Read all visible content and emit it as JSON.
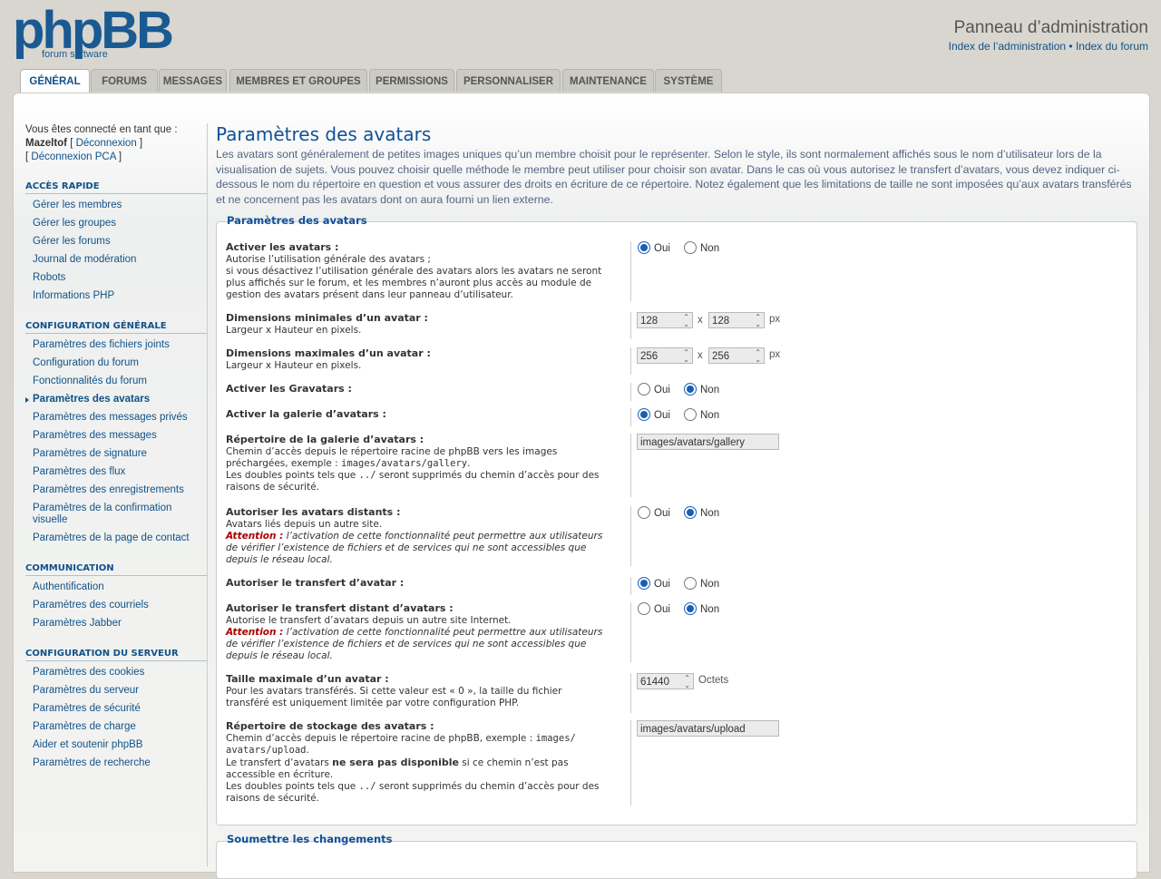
{
  "header": {
    "logo_main": "phpBB",
    "logo_sub": "forum software",
    "admin_title": "Panneau d’administration",
    "link_admin_index": "Index de l’administration",
    "link_separator": "•",
    "link_forum_index": "Index du forum"
  },
  "tabs": [
    "GÉNÉRAL",
    "FORUMS",
    "MESSAGES",
    "MEMBRES ET GROUPES",
    "PERMISSIONS",
    "PERSONNALISER",
    "MAINTENANCE",
    "SYSTÈME"
  ],
  "user": {
    "logged_as": "Vous êtes connecté en tant que :",
    "username": "Mazeltof",
    "logout": "Déconnexion",
    "logout_acp": "Déconnexion PCA"
  },
  "menu": [
    {
      "title": "ACCÈS RAPIDE",
      "items": [
        "Gérer les membres",
        "Gérer les groupes",
        "Gérer les forums",
        "Journal de modération",
        "Robots",
        "Informations PHP"
      ]
    },
    {
      "title": "CONFIGURATION GÉNÉRALE",
      "items": [
        "Paramètres des fichiers joints",
        "Configuration du forum",
        "Fonctionnalités du forum",
        "Paramètres des avatars",
        "Paramètres des messages privés",
        "Paramètres des messages",
        "Paramètres de signature",
        "Paramètres des flux",
        "Paramètres des enregistrements",
        "Paramètres de la confirmation visuelle",
        "Paramètres de la page de contact"
      ]
    },
    {
      "title": "COMMUNICATION",
      "items": [
        "Authentification",
        "Paramètres des courriels",
        "Paramètres Jabber"
      ]
    },
    {
      "title": "CONFIGURATION DU SERVEUR",
      "items": [
        "Paramètres des cookies",
        "Paramètres du serveur",
        "Paramètres de sécurité",
        "Paramètres de charge",
        "Aider et soutenir phpBB",
        "Paramètres de recherche"
      ]
    }
  ],
  "page": {
    "title": "Paramètres des avatars",
    "intro": "Les avatars sont généralement de petites images uniques qu’un membre choisit pour le représenter. Selon le style, ils sont normalement affichés sous le nom d’utilisateur lors de la visualisation de sujets. Vous pouvez choisir quelle méthode le membre peut utiliser pour choisir son avatar. Dans le cas où vous autorisez le transfert d’avatars, vous devez indiquer ci-dessous le nom du répertoire en question et vous assurer des droits en écriture de ce répertoire. Notez également que les limitations de taille ne sont imposées qu’aux avatars transférés et ne concernent pas les avatars dont on aura fourni un lien externe.",
    "legend": "Paramètres des avatars",
    "submit_legend": "Soumettre les changements"
  },
  "common": {
    "yes": "Oui",
    "no": "Non",
    "px": "px",
    "x": "x",
    "octets": "Octets",
    "attention": "Attention :"
  },
  "settings": {
    "enable": {
      "title": "Activer les avatars :",
      "l1": "Autorise l’utilisation générale des avatars ;",
      "l2": "si vous désactivez l’utilisation générale des avatars alors les avatars ne seront",
      "l3": "plus affichés sur le forum, et les membres n’auront plus accès au module de",
      "l4": "gestion des avatars présent dans leur panneau d’utilisateur.",
      "value": "oui"
    },
    "min": {
      "title": "Dimensions minimales d’un avatar :",
      "desc": "Largeur x Hauteur en pixels.",
      "w": "128",
      "h": "128"
    },
    "max": {
      "title": "Dimensions maximales d’un avatar :",
      "desc": "Largeur x Hauteur en pixels.",
      "w": "256",
      "h": "256"
    },
    "gravatar": {
      "title": "Activer les Gravatars :",
      "value": "non"
    },
    "gallery": {
      "title": "Activer la galerie d’avatars :",
      "value": "oui"
    },
    "gallery_path": {
      "title": "Répertoire de la galerie d’avatars :",
      "l1": "Chemin d’accès depuis le répertoire racine de phpBB vers les images",
      "l2a": "préchargées, exemple : ",
      "l2code": "images/avatars/gallery",
      "l2b": ".",
      "l3a": "Les doubles points tels que ",
      "l3code": "../",
      "l3b": " seront supprimés du chemin d’accès pour des",
      "l4": "raisons de sécurité.",
      "value": "images/avatars/gallery"
    },
    "remote": {
      "title": "Autoriser les avatars distants :",
      "desc": "Avatars liés depuis un autre site.",
      "w1": " l’activation de cette fonctionnalité peut permettre aux utilisateurs",
      "w2": "de vérifier l’existence de fichiers et de services qui ne sont accessibles que",
      "w3": "depuis le réseau local.",
      "value": "non"
    },
    "upload": {
      "title": "Autoriser le transfert d’avatar :",
      "value": "oui"
    },
    "remote_upload": {
      "title": "Autoriser le transfert distant d’avatars :",
      "desc": "Autorise le transfert d’avatars depuis un autre site Internet.",
      "w1": " l’activation de cette fonctionnalité peut permettre aux utilisateurs",
      "w2": "de vérifier l’existence de fichiers et de services qui ne sont accessibles que",
      "w3": "depuis le réseau local.",
      "value": "non"
    },
    "filesize": {
      "title": "Taille maximale d’un avatar :",
      "l1": "Pour les avatars transférés. Si cette valeur est « 0 », la taille du fichier",
      "l2": "transféré est uniquement limitée par votre configuration PHP.",
      "value": "61440"
    },
    "storage": {
      "title": "Répertoire de stockage des avatars :",
      "l1a": "Chemin d’accès depuis le répertoire racine de phpBB, exemple : ",
      "l1code": "images/",
      "l2code": "avatars/upload",
      "l2b": ".",
      "l3a": "Le transfert d’avatars ",
      "l3b": "ne sera pas disponible",
      "l3c": " si ce chemin n’est pas",
      "l4": "accessible en écriture.",
      "l5a": "Les doubles points tels que ",
      "l5code": "../",
      "l5b": " seront supprimés du chemin d’accès pour des",
      "l6": "raisons de sécurité.",
      "value": "images/avatars/upload"
    }
  }
}
